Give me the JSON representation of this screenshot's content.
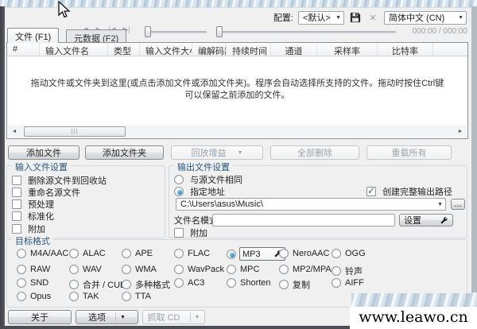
{
  "colors": {
    "accent_check": "#3566a8",
    "radio_dot": "#1f7ac4",
    "window_bg": "#f0f0f0",
    "group_title": "#27557e"
  },
  "topbar": {
    "config_label": "配置:",
    "config_value": "<默认>",
    "language_value": "简体中文 (CN)"
  },
  "player": {
    "stop": "■",
    "play": "▶",
    "prev": "|◀",
    "next": "▶|",
    "time_display": "000:00 / 000:00"
  },
  "tabs": [
    {
      "label": "文件 (F1)"
    },
    {
      "label": "元数据 (F2)"
    }
  ],
  "file_table": {
    "columns": [
      "#",
      "输入文件名",
      "类型",
      "输入文件大小",
      "编解码器",
      "持续时间",
      "通道",
      "采样率",
      "比特率"
    ],
    "empty_hint_line1": "拖动文件或文件夹到这里(或点击添加文件或添加文件夹)。程序会自动选择所支持的文件。拖动时按住Ctrl键",
    "empty_hint_line2": "可以保留之前添加的文件。",
    "scroll_left_icon": "◄",
    "scroll_right_icon": "►",
    "thumb_grip": "|||"
  },
  "action_buttons": [
    {
      "label": "添加文件",
      "enabled": true
    },
    {
      "label": "添加文件夹",
      "enabled": true
    },
    {
      "label": "回放增益",
      "enabled": false,
      "has_dropdown": true
    },
    {
      "label": "全部删除",
      "enabled": false
    },
    {
      "label": "重载所有",
      "enabled": false
    }
  ],
  "input_settings": {
    "title": "输入文件设置",
    "items": [
      "删除源文件到回收站",
      "重命名源文件",
      "预处理",
      "标准化",
      "附加"
    ]
  },
  "output_settings": {
    "title": "输出文件设置",
    "same_as_source": "与源文件相同",
    "custom_path": "指定地址",
    "create_full_path": "创建完整输出路径",
    "path_value": "C:\\Users\\asus\\Music\\",
    "browse_label": "...",
    "pattern_label": "文件名模式:",
    "pattern_value": "",
    "settings_button": "设置",
    "append": "附加"
  },
  "target_format": {
    "title": "目标格式",
    "selected": "MP3",
    "rows": [
      [
        "M4A/AAC",
        "ALAC",
        "APE",
        "FLAC",
        "MP3",
        "NeroAAC",
        "OGG"
      ],
      [
        "RAW",
        "WAV",
        "WMA",
        "WavPack",
        "MPC",
        "MP2/MPA",
        "铃声"
      ],
      [
        "SND",
        "合并 / CUE",
        "多种格式",
        "AC3",
        "Shorten",
        "复制",
        "AIFF"
      ],
      [
        "Opus",
        "TAK",
        "TTA"
      ]
    ]
  },
  "bottom_bar": {
    "about": "关于",
    "options": "选项",
    "rip_cd": "抓取 CD"
  },
  "watermark": "www.leawo.cn"
}
